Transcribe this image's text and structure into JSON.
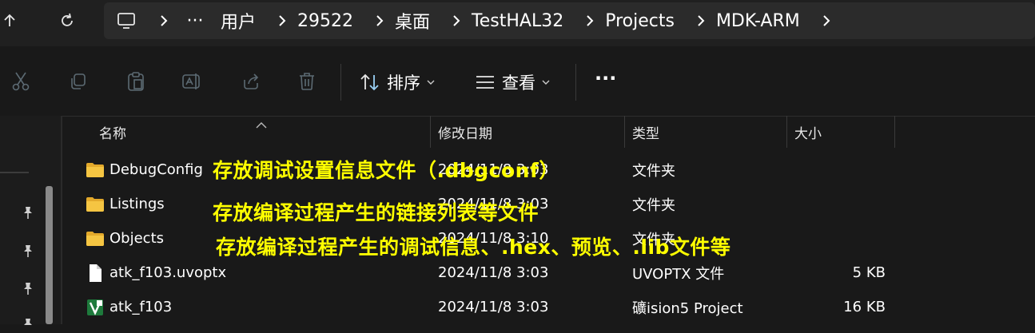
{
  "address_bar": {
    "crumbs": [
      "用户",
      "29522",
      "桌面",
      "TestHAL32",
      "Projects",
      "MDK-ARM"
    ],
    "more": "···"
  },
  "toolbar": {
    "sort_label": "排序",
    "view_label": "查看",
    "more_label": "···"
  },
  "columns": {
    "name": "名称",
    "date": "修改日期",
    "type": "类型",
    "size": "大小"
  },
  "files": [
    {
      "name": "DebugConfig",
      "date": "2024/11/8 3:03",
      "type": "文件夹",
      "size": "",
      "icon": "folder-icon"
    },
    {
      "name": "Listings",
      "date": "2024/11/8 3:03",
      "type": "文件夹",
      "size": "",
      "icon": "folder-icon"
    },
    {
      "name": "Objects",
      "date": "2024/11/8 3:10",
      "type": "文件夹",
      "size": "",
      "icon": "folder-icon"
    },
    {
      "name": "atk_f103.uvoptx",
      "date": "2024/11/8 3:03",
      "type": "UVOPTX 文件",
      "size": "5 KB",
      "icon": "file-icon"
    },
    {
      "name": "atk_f103",
      "date": "2024/11/8 3:03",
      "type": "礦ision5 Project",
      "size": "16 KB",
      "icon": "keil-project-icon"
    }
  ],
  "annotations": [
    "存放调试设置信息文件（.dbgconf）",
    "存放编译过程产生的链接列表等文件",
    "存放编译过程产生的调试信息、.hex、预览、.lib文件等"
  ],
  "colors": {
    "annotation": "#ffff00",
    "folder": "#f2c94c",
    "background": "#191919"
  }
}
